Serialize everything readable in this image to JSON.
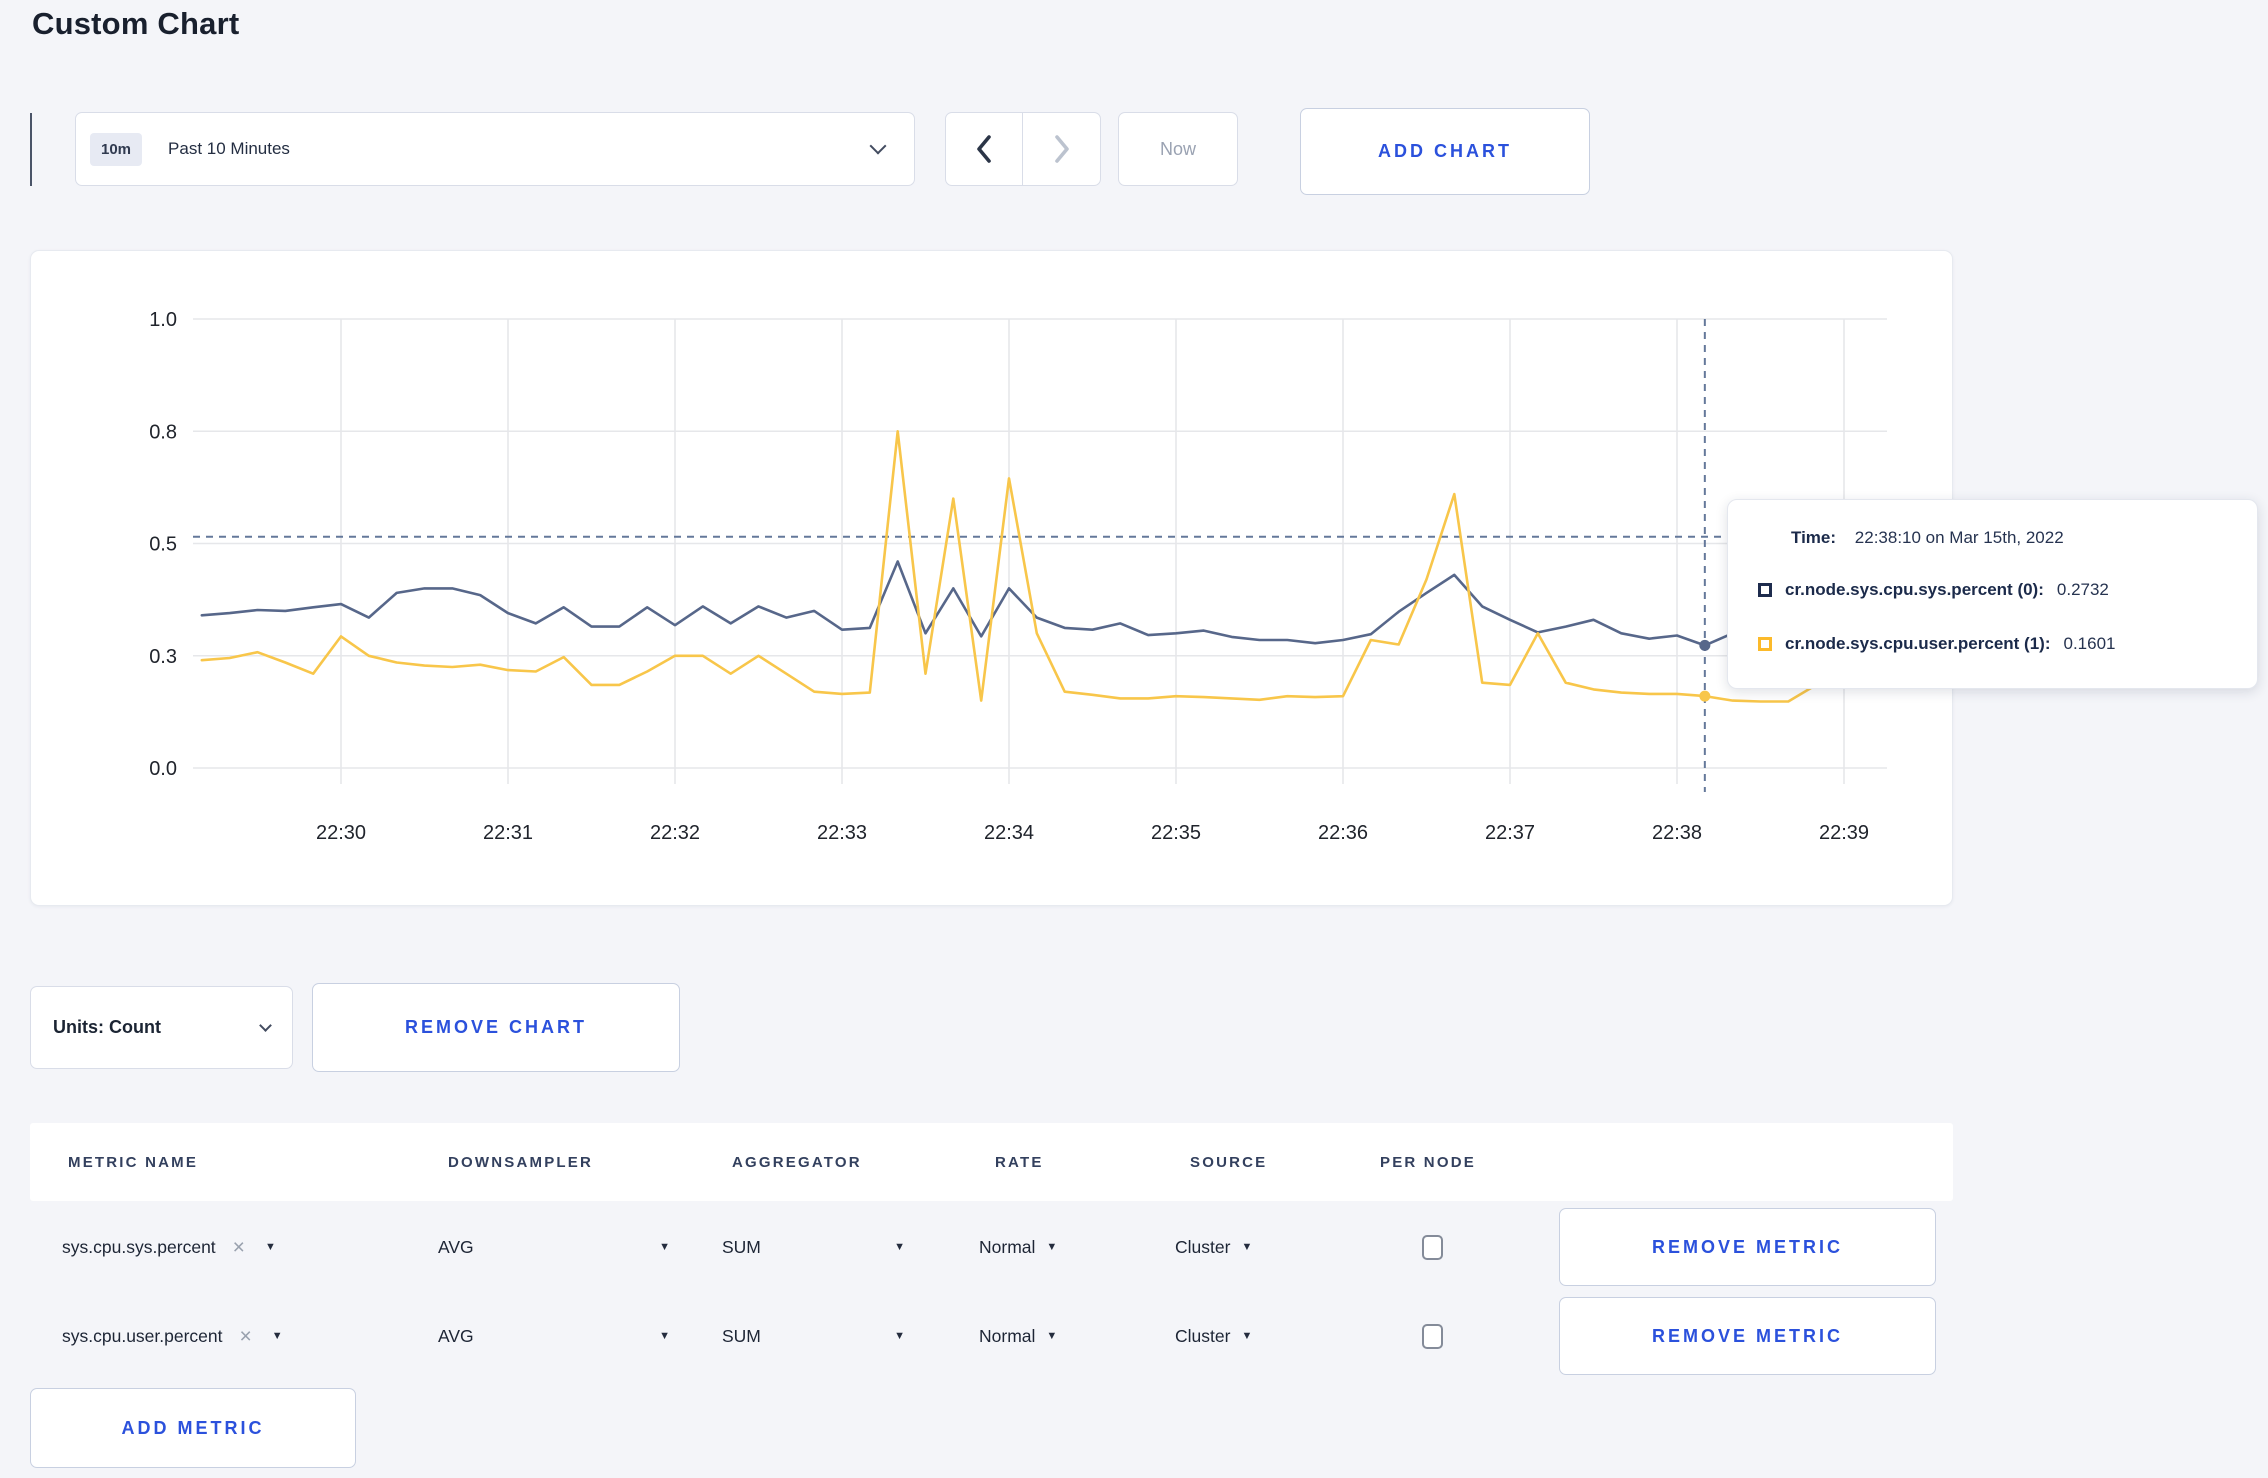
{
  "page": {
    "title": "Custom Chart"
  },
  "toolbar": {
    "range_badge": "10m",
    "range_label": "Past 10 Minutes",
    "now_label": "Now",
    "add_chart_label": "ADD CHART"
  },
  "icons": {
    "caret_down": "▼",
    "close": "×"
  },
  "tooltip": {
    "time_label": "Time:",
    "time_value": "22:38:10 on Mar 15th, 2022",
    "series": [
      {
        "name": "cr.node.sys.cpu.sys.percent (0):",
        "value": "0.2732",
        "color": "#1e2c4d"
      },
      {
        "name": "cr.node.sys.cpu.user.percent (1):",
        "value": "0.1601",
        "color": "#fcba2a"
      }
    ]
  },
  "units": {
    "label": "Units: Count",
    "remove_chart_label": "REMOVE CHART"
  },
  "metrics_table": {
    "headers": [
      "METRIC NAME",
      "DOWNSAMPLER",
      "AGGREGATOR",
      "RATE",
      "SOURCE",
      "PER NODE"
    ],
    "rows": [
      {
        "metric": "sys.cpu.sys.percent",
        "downsampler": "AVG",
        "aggregator": "SUM",
        "rate": "Normal",
        "source": "Cluster",
        "per_node": false,
        "remove_label": "REMOVE METRIC"
      },
      {
        "metric": "sys.cpu.user.percent",
        "downsampler": "AVG",
        "aggregator": "SUM",
        "rate": "Normal",
        "source": "Cluster",
        "per_node": false,
        "remove_label": "REMOVE METRIC"
      }
    ],
    "add_metric_label": "ADD METRIC"
  },
  "chart_data": {
    "type": "line",
    "title": "",
    "xlabel": "",
    "ylabel": "",
    "ylim": [
      0,
      1
    ],
    "grid": true,
    "legend_position": "tooltip-only",
    "x_start": "22:29:10",
    "x_step_seconds": 10,
    "x_ticks": [
      "22:30",
      "22:31",
      "22:32",
      "22:33",
      "22:34",
      "22:35",
      "22:36",
      "22:37",
      "22:38",
      "22:39"
    ],
    "y_ticks": [
      {
        "v": 0.0,
        "label": "0.0"
      },
      {
        "v": 0.25,
        "label": "0.3"
      },
      {
        "v": 0.5,
        "label": "0.5"
      },
      {
        "v": 0.75,
        "label": "0.8"
      },
      {
        "v": 1.0,
        "label": "1.0"
      }
    ],
    "series": [
      {
        "name": "cr.node.sys.cpu.sys.percent",
        "color": "#57678a",
        "values": [
          0.34,
          0.345,
          0.352,
          0.35,
          0.358,
          0.365,
          0.335,
          0.39,
          0.4,
          0.4,
          0.385,
          0.345,
          0.322,
          0.358,
          0.315,
          0.315,
          0.358,
          0.318,
          0.36,
          0.322,
          0.36,
          0.335,
          0.35,
          0.308,
          0.312,
          0.46,
          0.3,
          0.4,
          0.293,
          0.4,
          0.335,
          0.312,
          0.308,
          0.322,
          0.296,
          0.3,
          0.306,
          0.292,
          0.285,
          0.285,
          0.278,
          0.285,
          0.298,
          0.348,
          0.39,
          0.43,
          0.36,
          0.33,
          0.302,
          0.315,
          0.33,
          0.3,
          0.288,
          0.295,
          0.273,
          0.3,
          0.296,
          0.298,
          0.315,
          0.268,
          0.308
        ]
      },
      {
        "name": "cr.node.sys.cpu.user.percent",
        "color": "#f8c64a",
        "values": [
          0.24,
          0.245,
          0.258,
          0.235,
          0.21,
          0.293,
          0.25,
          0.235,
          0.228,
          0.225,
          0.23,
          0.218,
          0.215,
          0.247,
          0.185,
          0.185,
          0.215,
          0.25,
          0.25,
          0.21,
          0.25,
          0.21,
          0.17,
          0.165,
          0.168,
          0.75,
          0.21,
          0.6,
          0.15,
          0.645,
          0.3,
          0.17,
          0.163,
          0.155,
          0.155,
          0.16,
          0.158,
          0.155,
          0.152,
          0.16,
          0.158,
          0.16,
          0.285,
          0.275,
          0.42,
          0.61,
          0.19,
          0.185,
          0.3,
          0.19,
          0.175,
          0.168,
          0.165,
          0.165,
          0.1601,
          0.15,
          0.148,
          0.148,
          0.185,
          0.3,
          0.235
        ]
      }
    ],
    "hover": {
      "index": 54,
      "time": "22:38:10",
      "hline_value": 0.515,
      "crosshair_color": "#64789a"
    },
    "gridline_color": "#e6e7ea"
  },
  "colors": {
    "accent_blue": "#2b51dc",
    "page_background": "#f4f5f9",
    "card_background": "#ffffff"
  }
}
